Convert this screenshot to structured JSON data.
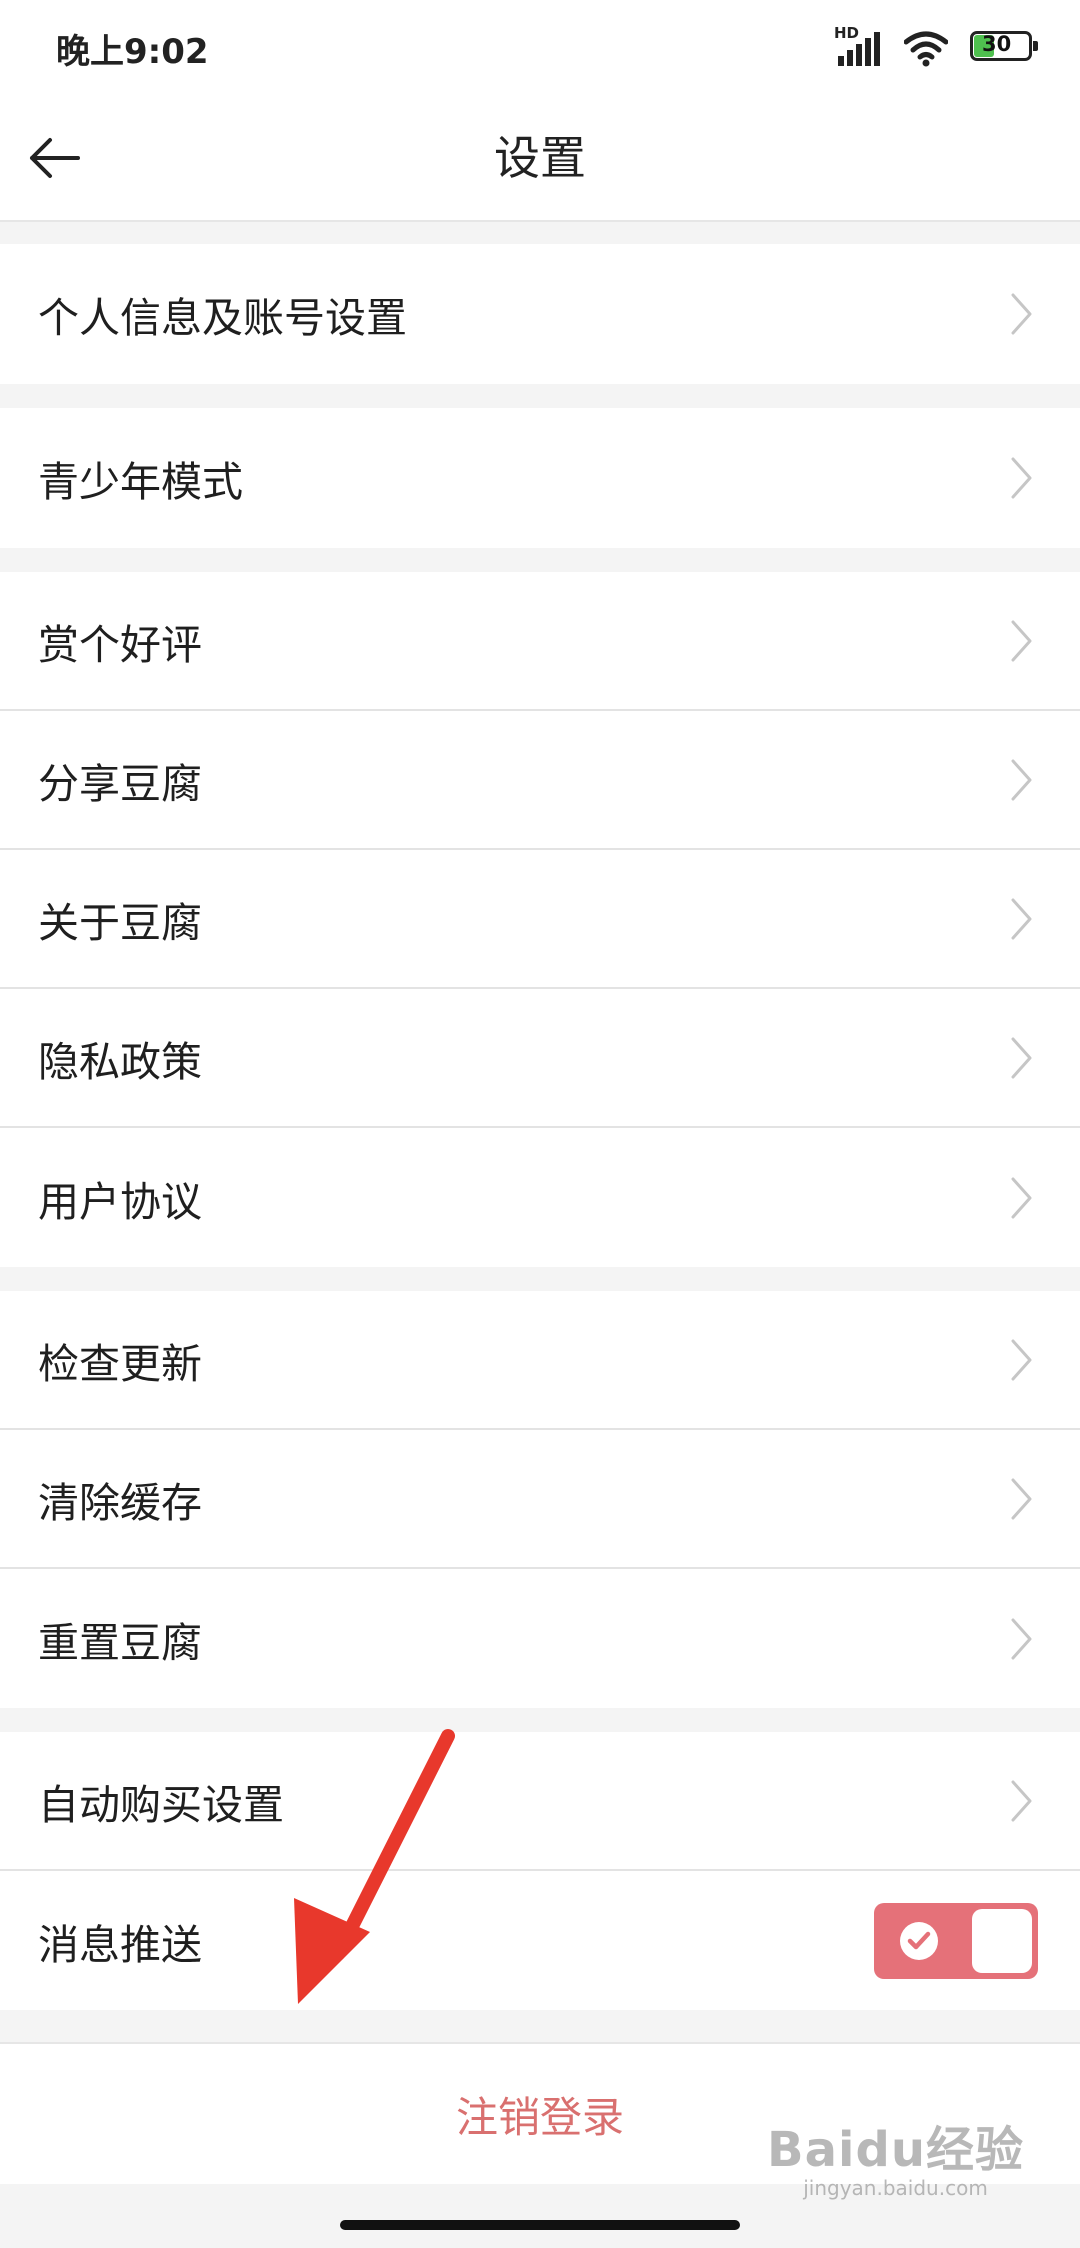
{
  "status_bar": {
    "time": "晚上9:02",
    "signal_label": "HD",
    "battery": "30"
  },
  "header": {
    "back_icon": "arrow-left-icon",
    "title": "设置"
  },
  "groups": [
    {
      "items": [
        {
          "label": "个人信息及账号设置"
        }
      ]
    },
    {
      "items": [
        {
          "label": "青少年模式"
        }
      ]
    },
    {
      "items": [
        {
          "label": "赏个好评"
        },
        {
          "label": "分享豆腐"
        },
        {
          "label": "关于豆腐"
        },
        {
          "label": "隐私政策"
        },
        {
          "label": "用户协议"
        }
      ]
    },
    {
      "items": [
        {
          "label": "检查更新"
        },
        {
          "label": "清除缓存"
        },
        {
          "label": "重置豆腐"
        }
      ]
    },
    {
      "items": [
        {
          "label": "自动购买设置"
        },
        {
          "label": "消息推送",
          "toggle_on": true
        }
      ]
    }
  ],
  "logout": {
    "label": "注销登录"
  },
  "watermark": {
    "logo": "Baidu经验",
    "sub": "jingyan.baidu.com"
  },
  "colors": {
    "toggle_on": "#e57179",
    "logout_text": "#d9706f",
    "annotation_arrow": "#e8382c"
  }
}
